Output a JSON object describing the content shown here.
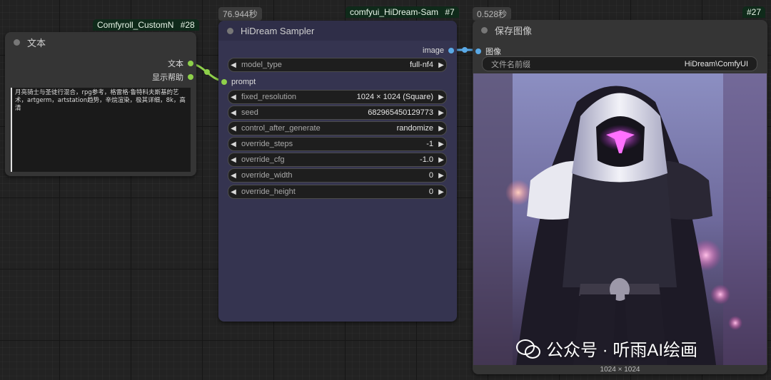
{
  "nodes": {
    "text_node": {
      "badge_name": "Comfyroll_CustomN",
      "badge_id": "#28",
      "title": "文本",
      "outputs": [
        "文本",
        "显示帮助"
      ],
      "text": "月亮骑士与圣徒行混合，rpg参考，格雷格·鲁特科夫斯基的艺术，artgerm，artstation趋势，辛烷渲染，极其详细，8k，高清"
    },
    "sampler_node": {
      "badge_name": "comfyui_HiDream-Sam",
      "badge_id": "#7",
      "time": "76.944秒",
      "title": "HiDream Sampler",
      "output_label": "image",
      "input_label": "prompt",
      "widgets": [
        {
          "label": "model_type",
          "value": "full-nf4"
        },
        {
          "label": "fixed_resolution",
          "value": "1024 × 1024 (Square)"
        },
        {
          "label": "seed",
          "value": "682965450129773"
        },
        {
          "label": "control_after_generate",
          "value": "randomize"
        },
        {
          "label": "override_steps",
          "value": "-1"
        },
        {
          "label": "override_cfg",
          "value": "-1.0"
        },
        {
          "label": "override_width",
          "value": "0"
        },
        {
          "label": "override_height",
          "value": "0"
        }
      ]
    },
    "save_node": {
      "badge_id": "#27",
      "time": "0.528秒",
      "title": "保存图像",
      "input_label": "图像",
      "prefix_label": "文件名前缀",
      "prefix_value": "HiDream\\ComfyUI",
      "image_size": "1024 × 1024",
      "watermark": "公众号 · 听雨AI绘画"
    }
  },
  "colors": {
    "link_green": "#8ed04a",
    "link_blue": "#5aa9e6",
    "sampler_bg": "#353450",
    "node_bg": "#353535"
  }
}
